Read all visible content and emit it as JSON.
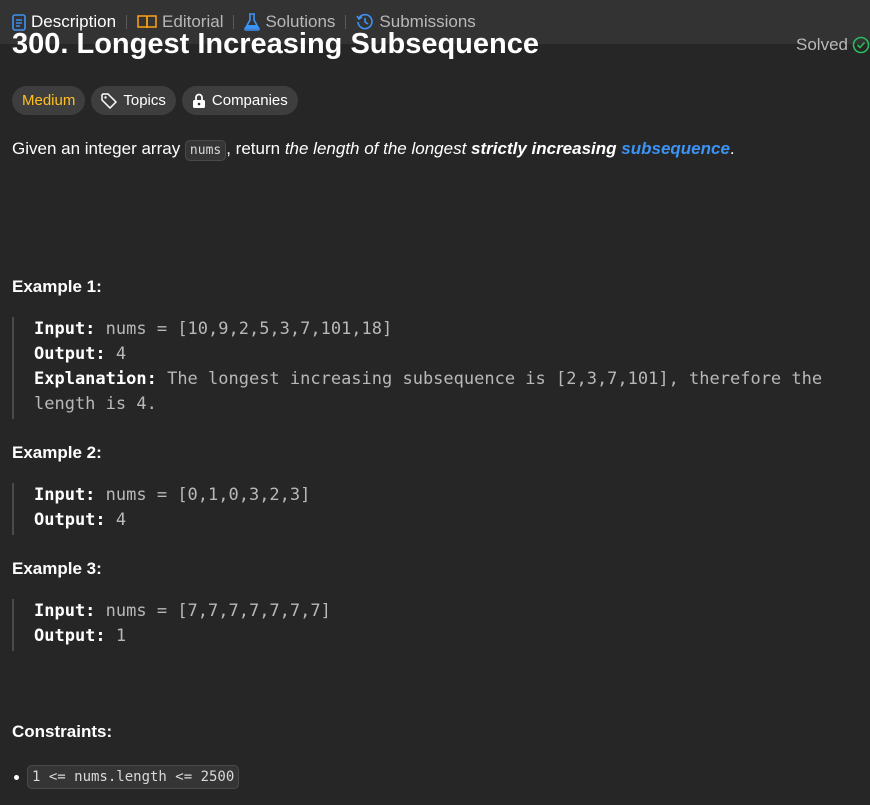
{
  "tabs": [
    {
      "label": "Description",
      "icon": "document-icon",
      "active": true
    },
    {
      "label": "Editorial",
      "icon": "book-icon",
      "active": false
    },
    {
      "label": "Solutions",
      "icon": "flask-icon",
      "active": false
    },
    {
      "label": "Submissions",
      "icon": "history-icon",
      "active": false
    }
  ],
  "problem": {
    "title": "300. Longest Increasing Subsequence",
    "status": "Solved",
    "tags": {
      "difficulty": "Medium",
      "topics": "Topics",
      "companies": "Companies"
    },
    "desc": {
      "p1": "Given an integer array ",
      "code": "nums",
      "p2": ", return ",
      "italic": "the length of the longest ",
      "bold": "strictly increasing ",
      "link": "subsequence",
      "end": "."
    }
  },
  "examples": [
    {
      "title": "Example 1:",
      "input_label": "Input:",
      "input": "nums = [10,9,2,5,3,7,101,18]",
      "output_label": "Output:",
      "output": "4",
      "explanation_label": "Explanation:",
      "explanation_line1": "The longest increasing subsequence is [2,3,7,101], therefore the",
      "explanation_line2": "length is 4."
    },
    {
      "title": "Example 2:",
      "input_label": "Input:",
      "input": "nums = [0,1,0,3,2,3]",
      "output_label": "Output:",
      "output": "4"
    },
    {
      "title": "Example 3:",
      "input_label": "Input:",
      "input": "nums = [7,7,7,7,7,7,7]",
      "output_label": "Output:",
      "output": "1"
    }
  ],
  "constraints": {
    "title": "Constraints:",
    "items": [
      "1 <= nums.length <= 2500"
    ]
  },
  "colors": {
    "accent": "#3c93f5",
    "medium": "#ffc01e",
    "solved": "#2cbb5d"
  }
}
